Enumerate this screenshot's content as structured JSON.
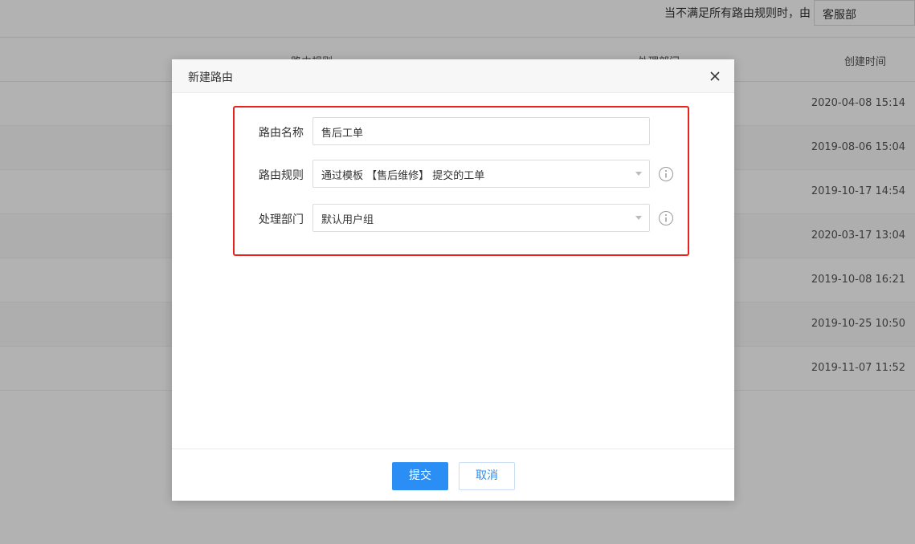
{
  "background": {
    "fallback_text": "当不满足所有路由规则时，由",
    "fallback_select_value": "客服部",
    "table_headers": [
      "路由规则",
      "处理部门",
      "创建时间"
    ],
    "rows": [
      {
        "created": "2020-04-08 15:14"
      },
      {
        "created": "2019-08-06 15:04"
      },
      {
        "created": "2019-10-17 14:54"
      },
      {
        "created": "2020-03-17 13:04"
      },
      {
        "created": "2019-10-08 16:21"
      },
      {
        "created": "2019-10-25 10:50"
      },
      {
        "created": "2019-11-07 11:52"
      }
    ]
  },
  "dialog": {
    "title": "新建路由",
    "fields": {
      "name": {
        "label": "路由名称",
        "value": "售后工单"
      },
      "rule": {
        "label": "路由规则",
        "value": "通过模板 【售后维修】 提交的工单"
      },
      "dept": {
        "label": "处理部门",
        "value": "默认用户组"
      }
    },
    "submit_label": "提交",
    "cancel_label": "取消"
  },
  "colors": {
    "primary": "#2a8ef5",
    "highlight": "#e8231e"
  }
}
